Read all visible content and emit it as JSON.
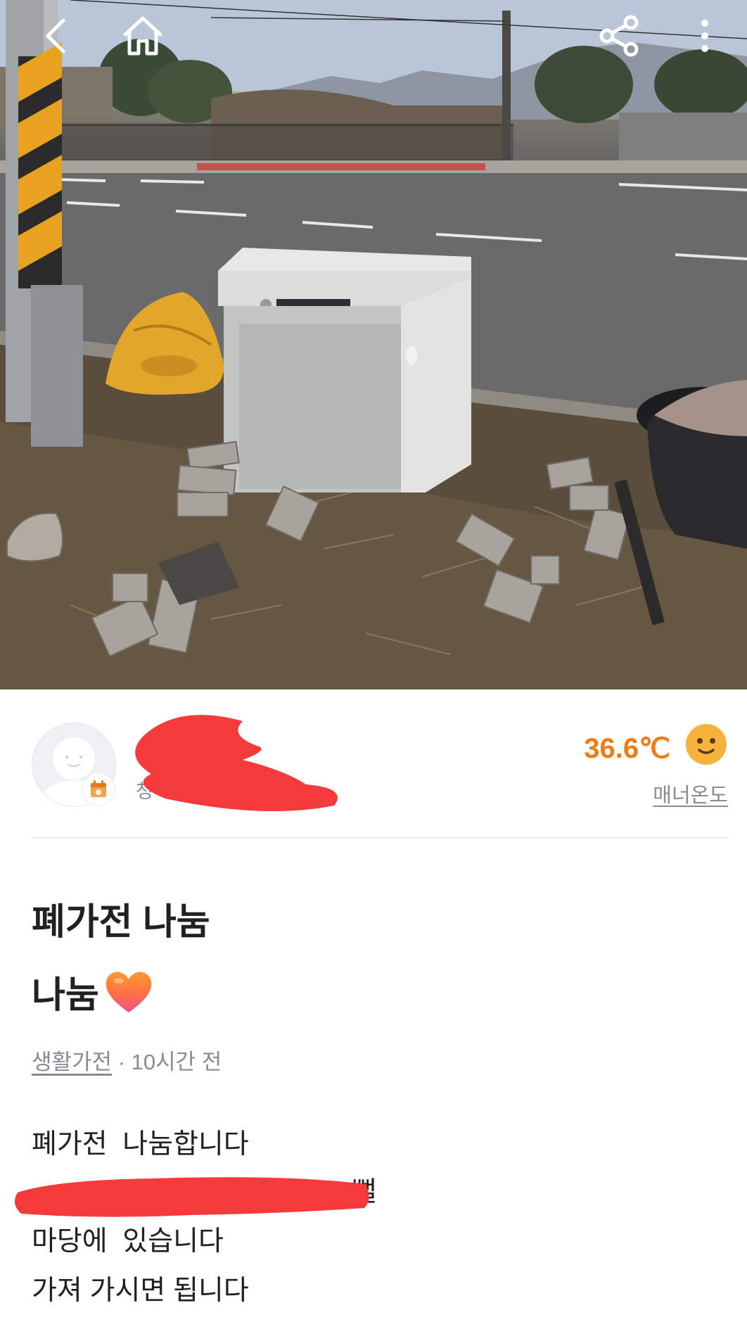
{
  "topbar": {
    "back_icon": "chevron-left-icon",
    "home_icon": "home-icon",
    "share_icon": "share-icon",
    "more_icon": "more-vertical-icon"
  },
  "photo": {
    "description_icon": "listing-photo"
  },
  "profile": {
    "nickname": "",
    "location": "청",
    "badge_icon": "calendar-badge-icon",
    "temperature": "36.6℃",
    "temperature_icon": "smiley-face-icon",
    "manner_label": "매너온도"
  },
  "post": {
    "title": "폐가전 나눔",
    "subtitle": "나눔",
    "subtitle_icon": "orange-heart-icon",
    "category": "생활가전",
    "time": " · 10시간 전",
    "body_lines": [
      "폐가전  나눔합니다",
      "",
      "마당에  있습니다",
      "가져 가시면 됩니다"
    ],
    "body_line2_tail": "뻘"
  },
  "colors": {
    "accent": "#f07b14",
    "text": "#212124",
    "muted": "#868b94",
    "divider": "#eaebee",
    "redaction": "#f43a3a"
  }
}
